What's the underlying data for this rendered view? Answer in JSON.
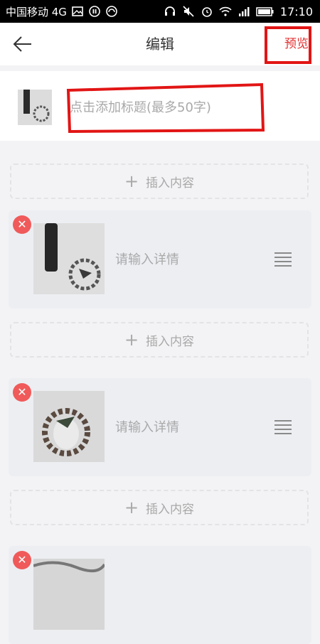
{
  "status_bar": {
    "carrier": "中国移动 4G",
    "time": "17:10",
    "network": "4G"
  },
  "header": {
    "title": "编辑",
    "preview_label": "预览",
    "back_icon": "back-arrow-icon"
  },
  "title_section": {
    "placeholder": "点击添加标题(最多50字)"
  },
  "insert_label": "插入内容",
  "items": [
    {
      "detail_placeholder": "请输入详情"
    },
    {
      "detail_placeholder": "请输入详情"
    }
  ],
  "colors": {
    "accent": "#e23030",
    "annotation": "#e21515",
    "delete": "#f05a5a"
  }
}
